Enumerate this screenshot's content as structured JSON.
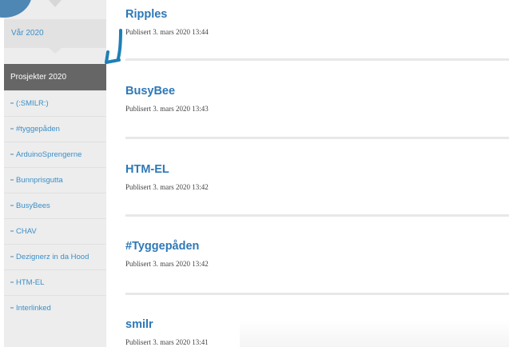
{
  "sidebar": {
    "season_label": "Vår 2020",
    "category_header": "Prosjekter 2020",
    "items": [
      {
        "label": "(:SMILR:)"
      },
      {
        "label": "#tyggepåden"
      },
      {
        "label": "ArduinoSprengerne"
      },
      {
        "label": "Bunnprisgutta"
      },
      {
        "label": "BusyBees"
      },
      {
        "label": "CHAV"
      },
      {
        "label": "Dezignerz in da Hood"
      },
      {
        "label": "HTM-EL"
      },
      {
        "label": "Interlinked"
      }
    ]
  },
  "posts": [
    {
      "title": "Ripples",
      "meta": "Publisert 3. mars 2020 13:44"
    },
    {
      "title": "BusyBee",
      "meta": "Publisert 3. mars 2020 13:43"
    },
    {
      "title": "HTM-EL",
      "meta": "Publisert 3. mars 2020 13:42"
    },
    {
      "title": "#Tyggepåden",
      "meta": "Publisert 3. mars 2020 13:42"
    },
    {
      "title": "smilr",
      "meta": "Publisert 3. mars 2020 13:41"
    }
  ],
  "colors": {
    "link": "#2e78b7",
    "sidebar_bg": "#ededed",
    "header_bg": "#666666",
    "annotation_arrow": "#1f7fb6"
  },
  "icons": {
    "annotation": "arrow-down-left-icon",
    "avatar": "avatar-icon"
  }
}
